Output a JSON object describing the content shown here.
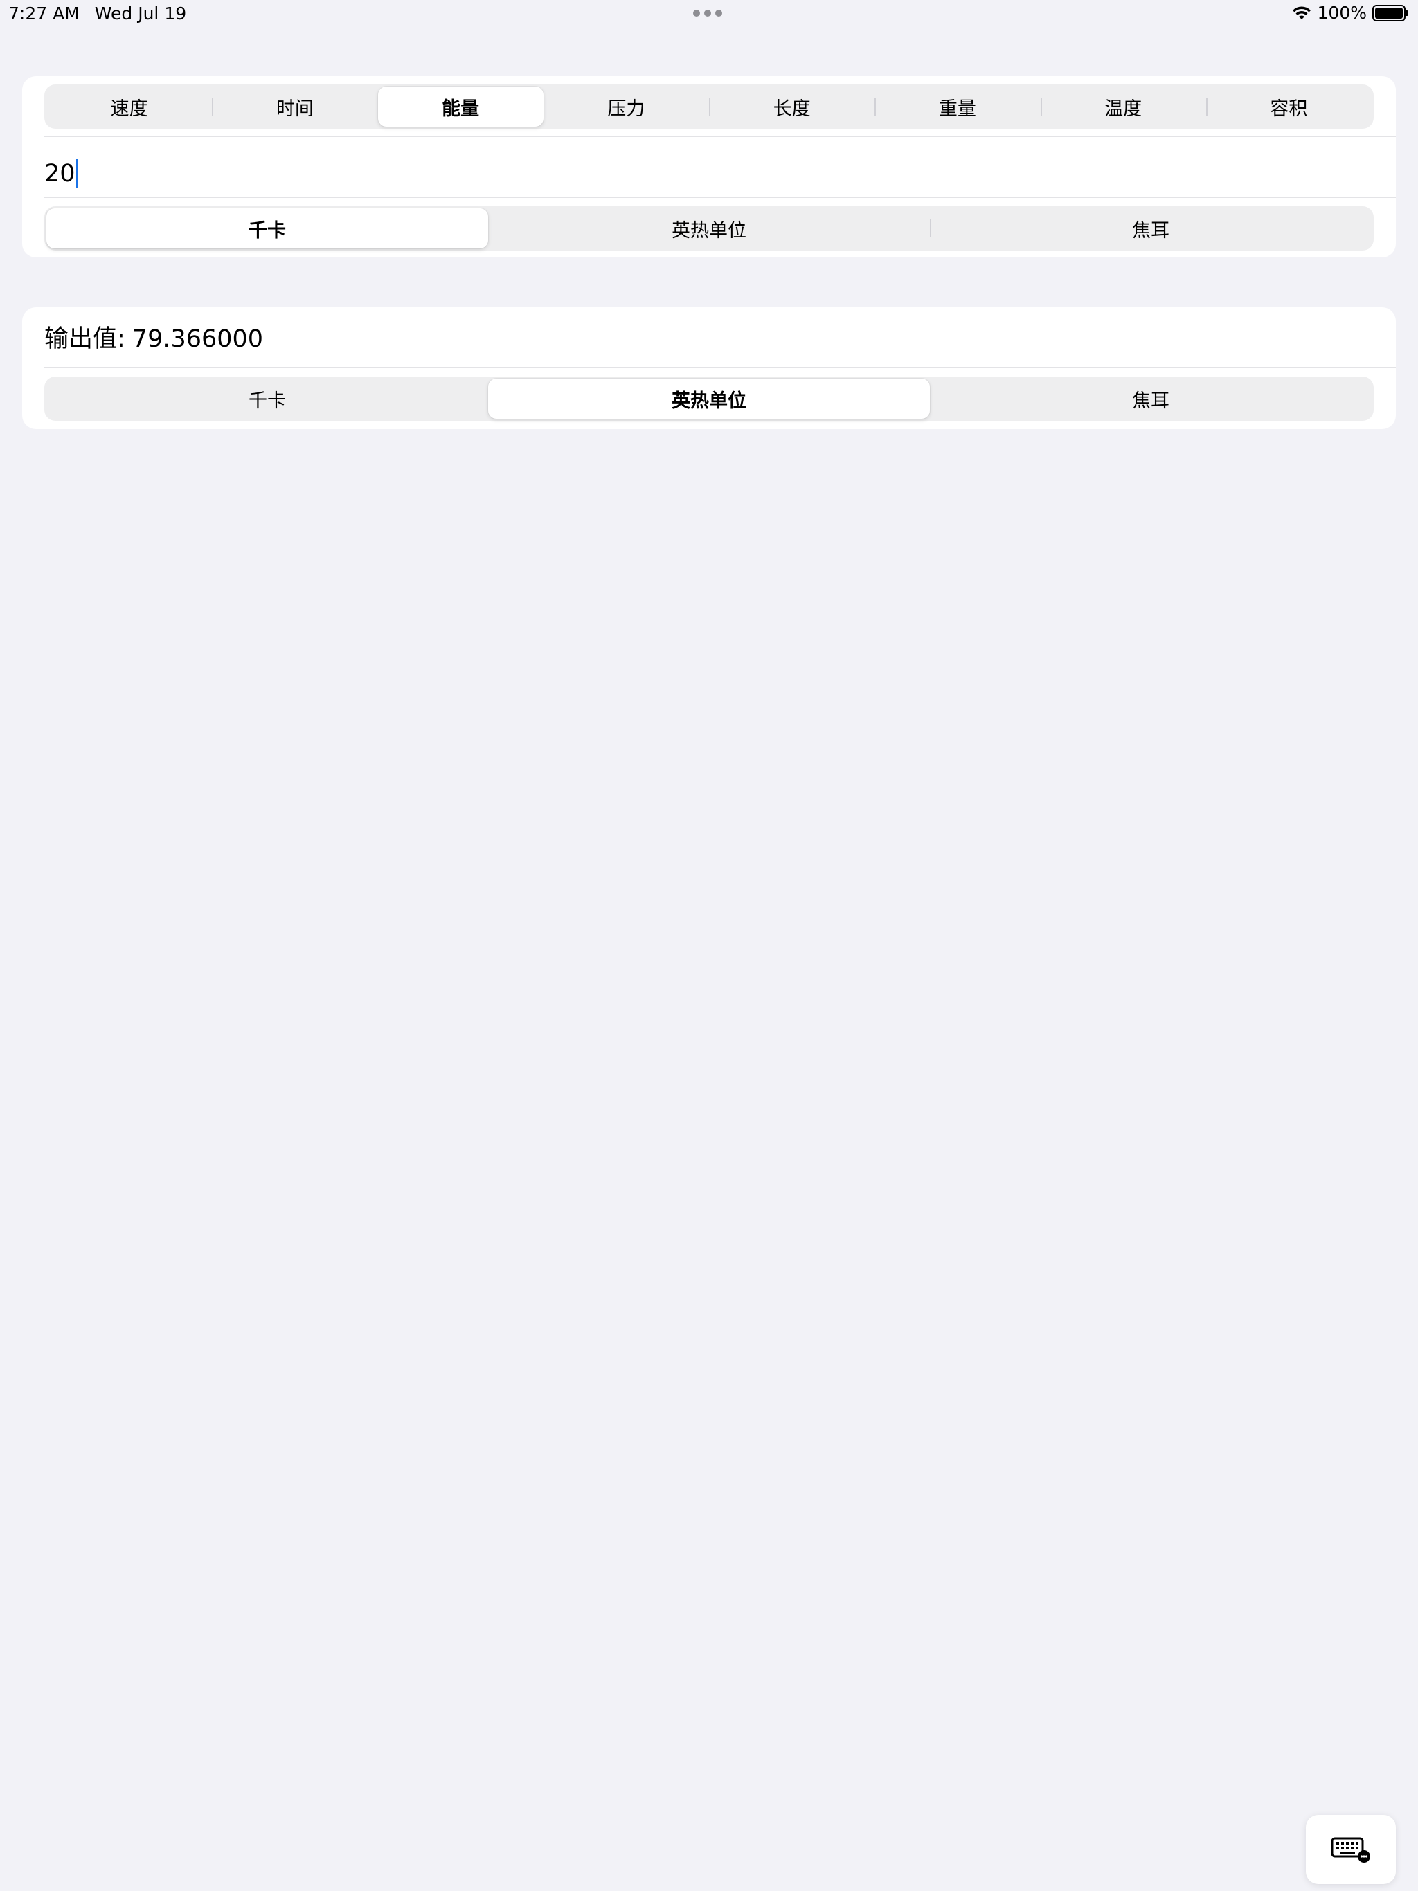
{
  "status_bar": {
    "time": "7:27 AM",
    "date": "Wed Jul 19",
    "battery": "100%"
  },
  "category_tabs": {
    "selected_index": 2,
    "items": [
      "速度",
      "时间",
      "能量",
      "压力",
      "长度",
      "重量",
      "温度",
      "容积"
    ]
  },
  "input": {
    "value": "20",
    "units": [
      "千卡",
      "英热单位",
      "焦耳"
    ],
    "selected_unit_index": 0
  },
  "output": {
    "label": "输出值:",
    "value": "79.366000",
    "units": [
      "千卡",
      "英热单位",
      "焦耳"
    ],
    "selected_unit_index": 1
  },
  "icons": {
    "wifi": "wifi-icon",
    "battery": "battery-icon",
    "keyboard": "keyboard-icon"
  },
  "colors": {
    "background": "#f2f2f7",
    "card": "#ffffff",
    "segment_track": "#eeeeef",
    "caret": "#1a73e8"
  }
}
